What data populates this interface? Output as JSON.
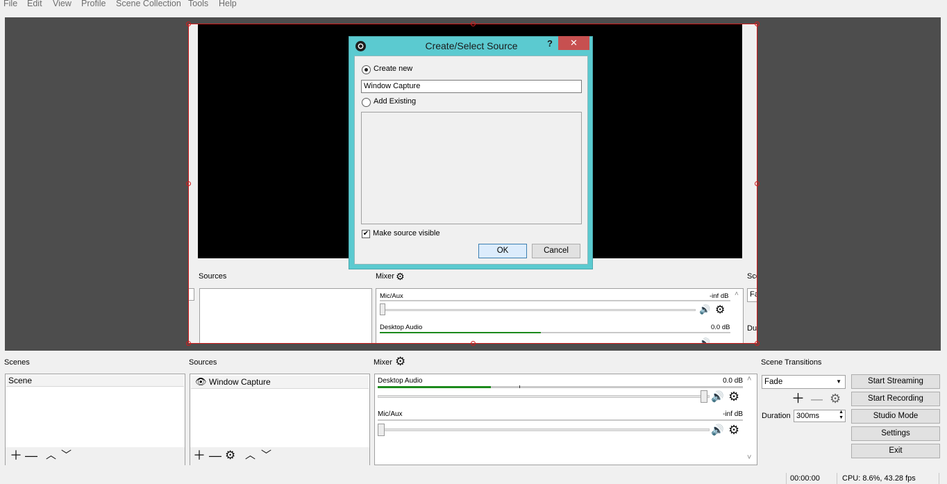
{
  "menu": [
    "File",
    "Edit",
    "View",
    "Profile",
    "Scene Collection",
    "Tools",
    "Help"
  ],
  "dialog": {
    "title": "Create/Select Source",
    "help": "?",
    "close": "✕",
    "create_new_label": "Create new",
    "name_value": "Window Capture",
    "add_existing_label": "Add Existing",
    "make_visible_label": "Make source visible",
    "make_visible_checked": true,
    "ok_label": "OK",
    "cancel_label": "Cancel"
  },
  "nested": {
    "sources_title": "Sources",
    "mixer_title": "Mixer",
    "mic_label": "Mic/Aux",
    "mic_value": "-inf dB",
    "desktop_label": "Desktop Audio",
    "desktop_value": "0.0 dB",
    "transitions_partial": "Sce",
    "fade_partial": "Fa",
    "duration_partial": "Du"
  },
  "scenes": {
    "title": "Scenes",
    "items": [
      "Scene"
    ]
  },
  "sources": {
    "title": "Sources",
    "items": [
      "Window Capture"
    ]
  },
  "mixer": {
    "title": "Mixer",
    "channels": [
      {
        "label": "Desktop Audio",
        "value": "0.0 dB",
        "level": 0.3
      },
      {
        "label": "Mic/Aux",
        "value": "-inf dB",
        "level": 0.0
      }
    ]
  },
  "transitions": {
    "title": "Scene Transitions",
    "selected": "Fade",
    "duration_label": "Duration",
    "duration_value": "300ms"
  },
  "controls": {
    "start_streaming": "Start Streaming",
    "start_recording": "Start Recording",
    "studio_mode": "Studio Mode",
    "settings": "Settings",
    "exit": "Exit"
  },
  "status": {
    "time": "00:00:00",
    "cpu": "CPU: 8.6%, 43.28 fps"
  },
  "colors": {
    "dialog_frame": "#5bcad0",
    "selection": "#d11b1b",
    "meter": "#1c8a1c",
    "close_button": "#c75050"
  }
}
